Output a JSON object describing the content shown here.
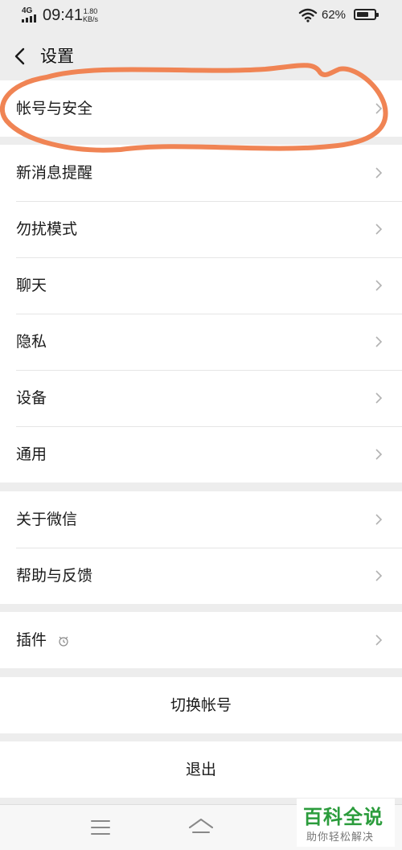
{
  "status_bar": {
    "network": "4G",
    "time": "09:41",
    "speed_value": "1.80",
    "speed_unit": "KB/s",
    "battery_percent": "62%",
    "icons": [
      "signal-icon",
      "wifi-icon",
      "battery-icon"
    ]
  },
  "header": {
    "back_icon": "chevron-left-icon",
    "title": "设置"
  },
  "groups": [
    {
      "items": [
        {
          "label": "帐号与安全"
        }
      ]
    },
    {
      "items": [
        {
          "label": "新消息提醒"
        },
        {
          "label": "勿扰模式"
        },
        {
          "label": "聊天"
        },
        {
          "label": "隐私"
        },
        {
          "label": "设备"
        },
        {
          "label": "通用"
        }
      ]
    },
    {
      "items": [
        {
          "label": "关于微信"
        },
        {
          "label": "帮助与反馈"
        }
      ]
    },
    {
      "items": [
        {
          "label": "插件",
          "icon": "plugin-status-icon"
        }
      ]
    }
  ],
  "actions": {
    "switch_account": "切换帐号",
    "logout": "退出"
  },
  "system_nav": {
    "icons": [
      "menu-icon",
      "home-icon"
    ]
  },
  "watermark": {
    "title": "百科全说",
    "subtitle": "助你轻松解决"
  },
  "colors": {
    "background": "#ededed",
    "card": "#ffffff",
    "annotation": "#f08454",
    "watermark_green": "#2b9c3c"
  }
}
